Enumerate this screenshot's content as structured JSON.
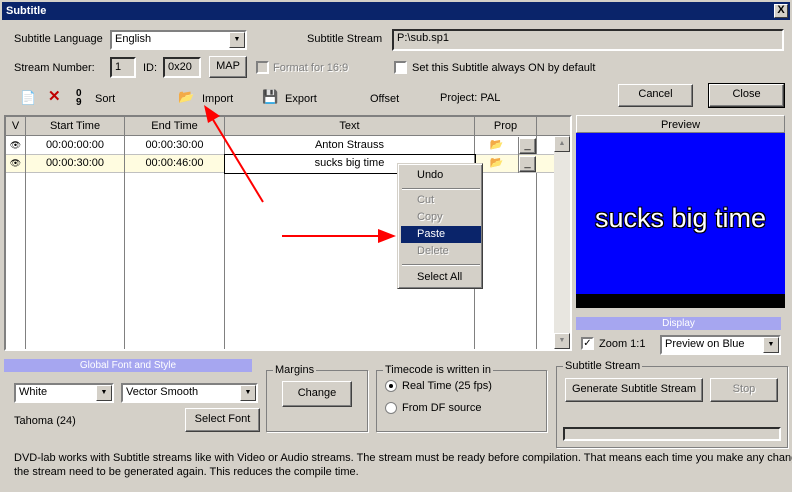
{
  "window": {
    "title": "Subtitle",
    "close_glyph": "X"
  },
  "top": {
    "lang_label": "Subtitle Language",
    "lang_value": "English",
    "stream_label": "Subtitle Stream",
    "stream_value": "P:\\sub.sp1",
    "number_label": "Stream Number:",
    "number_value": "1",
    "id_label": "ID:",
    "id_value": "0x20",
    "map_label": "MAP",
    "format_label": "Format for 16:9",
    "default_label": "Set this Subtitle always ON by default"
  },
  "toolbar": {
    "sort_label": "Sort",
    "import_label": "Import",
    "export_label": "Export",
    "offset_label": "Offset",
    "project_label": "Project: PAL",
    "cancel_label": "Cancel",
    "close_label": "Close"
  },
  "grid": {
    "headers": {
      "v": "V",
      "start": "Start Time",
      "end": "End Time",
      "text": "Text",
      "prop": "Prop",
      "preview": "Preview"
    },
    "rows": [
      {
        "start": "00:00:00:00",
        "end": "00:00:30:00",
        "text": "Anton Strauss",
        "prop_btn": "_"
      },
      {
        "start": "00:00:30:00",
        "end": "00:00:46:00",
        "text": "sucks big time",
        "prop_btn": "_"
      }
    ]
  },
  "context_menu": {
    "undo": "Undo",
    "cut": "Cut",
    "copy": "Copy",
    "paste": "Paste",
    "delete": "Delete",
    "select_all": "Select All"
  },
  "preview": {
    "text": "sucks big time",
    "display_label": "Display",
    "zoom_label": "Zoom 1:1",
    "mode_value": "Preview on Blue"
  },
  "font": {
    "title": "Global Font and Style",
    "color_value": "White",
    "smooth_value": "Vector Smooth",
    "font_name": "Tahoma (24)",
    "select_font_label": "Select Font"
  },
  "margins": {
    "title": "Margins",
    "change_label": "Change"
  },
  "timecode": {
    "title": "Timecode is written in",
    "real_label": "Real Time (25 fps)",
    "df_label": "From DF source"
  },
  "substream": {
    "title": "Subtitle Stream",
    "generate_label": "Generate Subtitle Stream",
    "stop_label": "Stop"
  },
  "footer": {
    "line1": "DVD-lab works with Subtitle streams like with Video or Audio streams. The stream must be ready before compilation. That means each time you make any changes",
    "line2": "the stream need to be generated again. This reduces the compile time."
  },
  "colors": {
    "titlebar": "#0a246a",
    "preview_bg": "#0000ff",
    "selection": "#0a246a",
    "row_highlight": "#fffce0",
    "arrow": "#ff0000"
  }
}
